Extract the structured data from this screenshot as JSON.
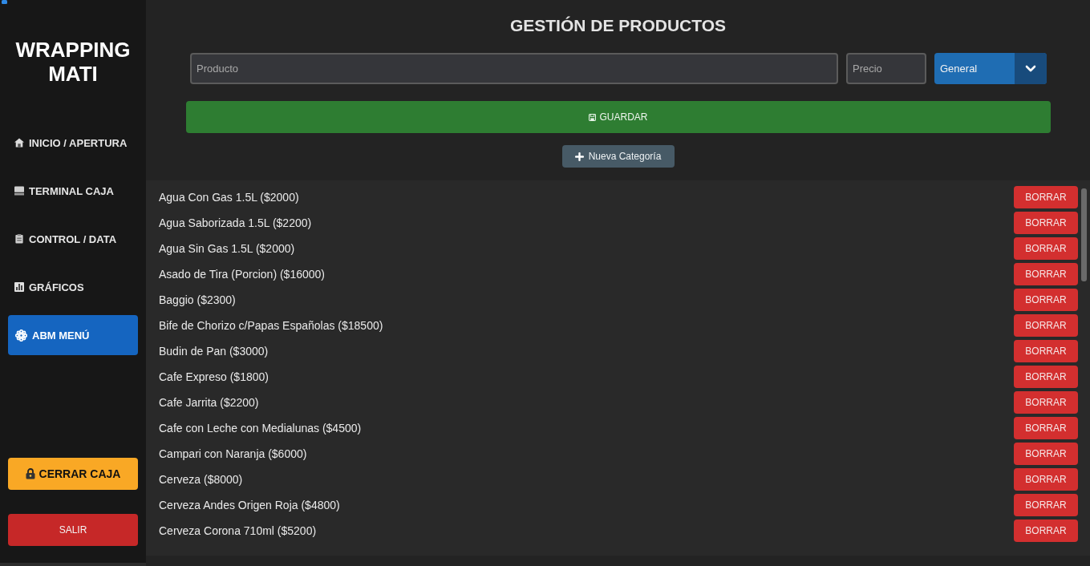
{
  "sidebar": {
    "brand": "WRAPPING MATI",
    "nav": [
      {
        "label": "INICIO / APERTURA",
        "selected": false
      },
      {
        "label": "TERMINAL CAJA",
        "selected": false
      },
      {
        "label": "CONTROL / DATA",
        "selected": false
      },
      {
        "label": "GRÁFICOS",
        "selected": false
      },
      {
        "label": "ABM MENÚ",
        "selected": true
      }
    ],
    "close_register": {
      "label": "CERRAR CAJA"
    },
    "exit": {
      "label": "SALIR"
    }
  },
  "main": {
    "title": "GESTIÓN DE PRODUCTOS",
    "form": {
      "product": {
        "placeholder": "Producto"
      },
      "price": {
        "placeholder": "Precio"
      },
      "category": {
        "value": "General"
      },
      "save": {
        "label": "GUARDAR"
      },
      "new_category": {
        "label": "Nueva Categoría"
      }
    },
    "products": [
      {
        "label": "Agua Con Gas 1.5L ($2000)",
        "action": "BORRAR"
      },
      {
        "label": "Agua Saborizada 1.5L ($2200)",
        "action": "BORRAR"
      },
      {
        "label": "Agua Sin Gas 1.5L ($2000)",
        "action": "BORRAR"
      },
      {
        "label": "Asado de Tira (Porcion) ($16000)",
        "action": "BORRAR"
      },
      {
        "label": "Baggio ($2300)",
        "action": "BORRAR"
      },
      {
        "label": "Bife de Chorizo c/Papas Españolas ($18500)",
        "action": "BORRAR"
      },
      {
        "label": "Budin de Pan ($3000)",
        "action": "BORRAR"
      },
      {
        "label": "Cafe Expreso ($1800)",
        "action": "BORRAR"
      },
      {
        "label": "Cafe Jarrita ($2200)",
        "action": "BORRAR"
      },
      {
        "label": "Cafe con Leche con Medialunas ($4500)",
        "action": "BORRAR"
      },
      {
        "label": "Campari con Naranja ($6000)",
        "action": "BORRAR"
      },
      {
        "label": "Cerveza ($8000)",
        "action": "BORRAR"
      },
      {
        "label": "Cerveza Andes Origen Roja ($4800)",
        "action": "BORRAR"
      },
      {
        "label": "Cerveza Corona 710ml ($5200)",
        "action": "BORRAR"
      }
    ]
  }
}
